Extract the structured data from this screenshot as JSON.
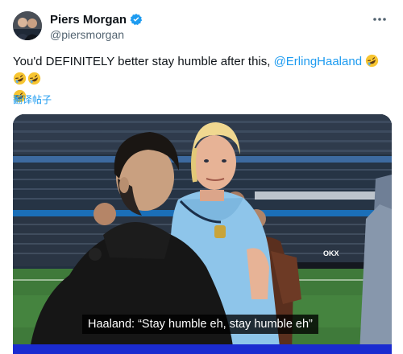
{
  "author": {
    "display_name": "Piers Morgan",
    "handle": "@piersmorgan",
    "verified": true
  },
  "tweet": {
    "text_before": "You'd DEFINITELY better stay humble after this, ",
    "mention": "@ErlingHaaland",
    "emoji": "rolling-on-floor-laughing"
  },
  "translate_label": "翻译帖子",
  "media": {
    "caption": "Haaland: “Stay humble eh, stay humble eh”",
    "pitch_board_text": "OKX"
  },
  "colors": {
    "accent": "#1d9bf0",
    "text": "#0f1419",
    "secondary": "#536471",
    "haaland_shirt": "#8ec5ea"
  }
}
